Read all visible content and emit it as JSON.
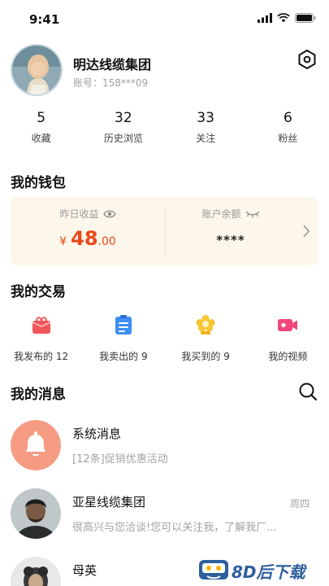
{
  "status_bar": {
    "time": "9:41"
  },
  "profile": {
    "name": "明达线缆集团",
    "account": "账号：158***09"
  },
  "stats": [
    {
      "value": "5",
      "label": "收藏"
    },
    {
      "value": "32",
      "label": "历史浏览"
    },
    {
      "value": "33",
      "label": "关注"
    },
    {
      "value": "6",
      "label": "粉丝"
    }
  ],
  "wallet": {
    "title": "我的钱包",
    "yesterday_label": "昨日收益",
    "yesterday_symbol": "¥",
    "yesterday_int": "48",
    "yesterday_dec": ".00",
    "balance_label": "账户余额",
    "balance_masked": "****"
  },
  "trades": {
    "title": "我的交易",
    "items": [
      {
        "label": "我发布的 12",
        "icon": "gift-icon"
      },
      {
        "label": "我卖出的 9",
        "icon": "clipboard-icon"
      },
      {
        "label": "我买到的 9",
        "icon": "flower-icon"
      },
      {
        "label": "我的视频",
        "icon": "video-icon"
      }
    ]
  },
  "messages": {
    "title": "我的消息",
    "items": [
      {
        "title": "系统消息",
        "preview": "[12条]促销优惠活动",
        "time": ""
      },
      {
        "title": "亚星线缆集团",
        "preview": "很高兴与您洽谈!您可以关注我，了解我厂...",
        "time": "周四"
      },
      {
        "title": "母英",
        "preview": "",
        "time": ""
      }
    ]
  },
  "watermark": {
    "text": "8D后下载"
  },
  "colors": {
    "accent": "#e9481b",
    "wallet_bg": "#fdf6ea",
    "system_msg": "#f49b82"
  }
}
